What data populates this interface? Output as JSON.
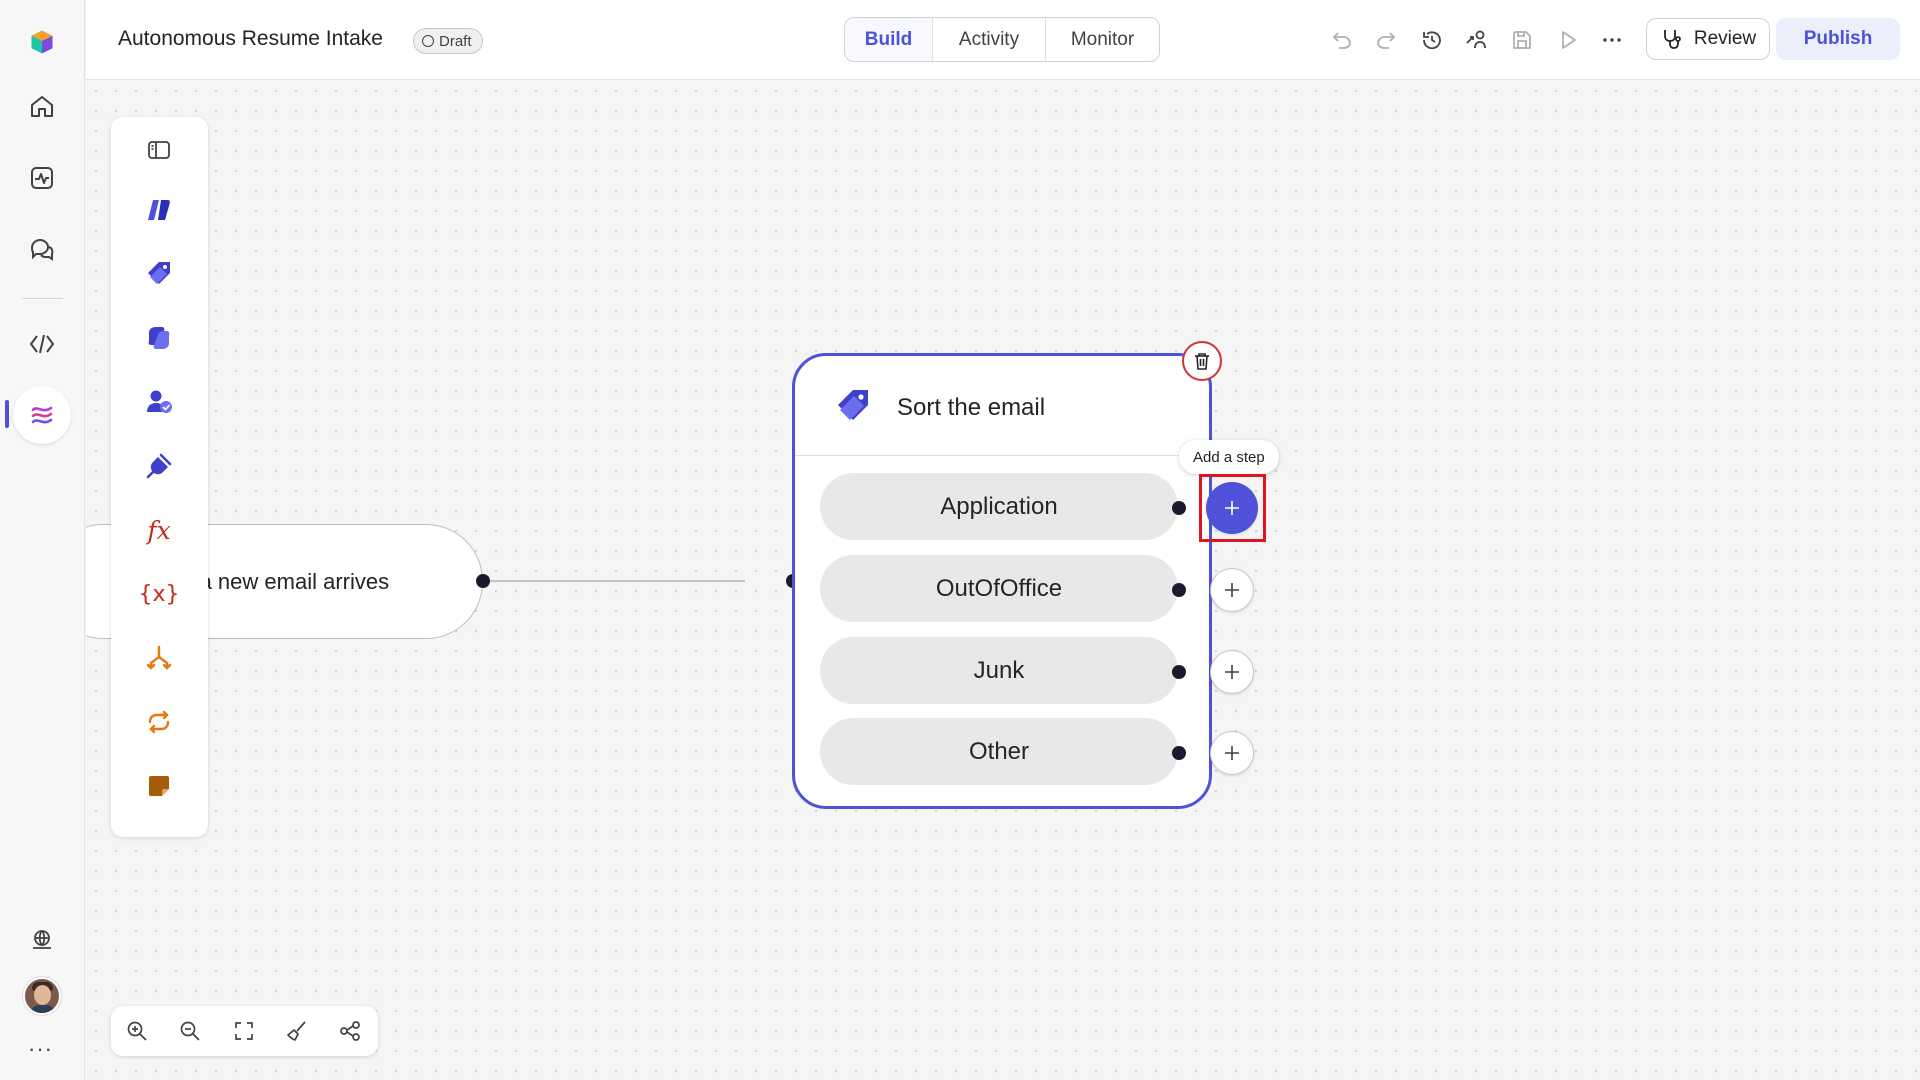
{
  "app": {
    "title": "Autonomous Resume Intake",
    "status_badge": "Draft"
  },
  "header": {
    "tabs": [
      {
        "label": "Build",
        "active": true
      },
      {
        "label": "Activity",
        "active": false
      },
      {
        "label": "Monitor",
        "active": false
      }
    ],
    "review_label": "Review",
    "publish_label": "Publish",
    "icons": [
      "undo-icon",
      "redo-icon",
      "history-icon",
      "connections-icon",
      "save-icon",
      "run-icon",
      "more-icon"
    ]
  },
  "rail": {
    "items": [
      "app-logo-icon",
      "home-icon",
      "activity-icon",
      "chat-icon",
      "code-icon",
      "flows-icon",
      "environment-icon",
      "avatar",
      "more-icon"
    ],
    "active_item": "flows-icon"
  },
  "toolbox": {
    "items": [
      "panel-toggle-icon",
      "ai-prompt-icon",
      "classify-tag-icon",
      "copilot-icon",
      "human-review-icon",
      "connector-plug-icon",
      "function-fx-icon",
      "variable-icon",
      "condition-branch-icon",
      "loop-icon",
      "note-icon"
    ],
    "fx_label": "fx",
    "var_label": "{x}"
  },
  "canvas": {
    "trigger": {
      "label": "en a new email arrives"
    },
    "switch_node": {
      "title": "Sort the email",
      "cases": [
        "Application",
        "OutOfOffice",
        "Junk",
        "Other"
      ]
    },
    "tooltip": "Add a step"
  },
  "colors": {
    "accent": "#4f52d8",
    "highlight": "#e0141e",
    "delete": "#d13438",
    "case_bg": "#e8e8e8"
  },
  "zoombar": {
    "items": [
      "zoom-in-icon",
      "zoom-out-icon",
      "fit-screen-icon",
      "cleanup-icon",
      "auto-layout-icon"
    ]
  }
}
